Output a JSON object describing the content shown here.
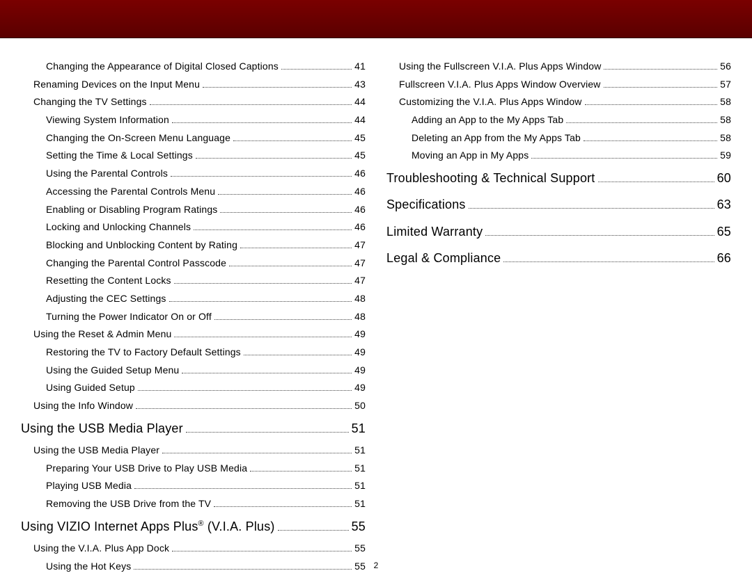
{
  "page_number": "2",
  "left": [
    {
      "class": "indent-2",
      "label": "Changing the Appearance of Digital Closed Captions",
      "page": "41"
    },
    {
      "class": "indent-1",
      "label": "Renaming Devices on the Input Menu",
      "page": "43"
    },
    {
      "class": "indent-1",
      "label": "Changing the TV Settings",
      "page": "44"
    },
    {
      "class": "indent-2",
      "label": "Viewing System Information",
      "page": "44"
    },
    {
      "class": "indent-2",
      "label": "Changing the On-Screen Menu Language",
      "page": "45"
    },
    {
      "class": "indent-2",
      "label": "Setting the Time & Local Settings",
      "page": "45"
    },
    {
      "class": "indent-2",
      "label": "Using the Parental Controls",
      "page": "46"
    },
    {
      "class": "indent-2",
      "label": "Accessing the Parental Controls Menu",
      "page": "46"
    },
    {
      "class": "indent-2",
      "label": "Enabling or Disabling Program Ratings",
      "page": "46"
    },
    {
      "class": "indent-2",
      "label": "Locking and Unlocking Channels",
      "page": "46"
    },
    {
      "class": "indent-2",
      "label": "Blocking and Unblocking Content by Rating",
      "page": "47"
    },
    {
      "class": "indent-2",
      "label": "Changing the Parental Control Passcode",
      "page": "47"
    },
    {
      "class": "indent-2",
      "label": "Resetting the Content Locks",
      "page": "47"
    },
    {
      "class": "indent-2",
      "label": "Adjusting the CEC Settings",
      "page": "48"
    },
    {
      "class": "indent-2",
      "label": "Turning the Power Indicator On or Off",
      "page": "48"
    },
    {
      "class": "indent-1",
      "label": "Using the Reset & Admin Menu",
      "page": "49"
    },
    {
      "class": "indent-2",
      "label": "Restoring the TV to Factory Default Settings",
      "page": "49"
    },
    {
      "class": "indent-2",
      "label": "Using the Guided Setup Menu",
      "page": "49"
    },
    {
      "class": "indent-2",
      "label": "Using Guided Setup",
      "page": "49"
    },
    {
      "class": "indent-1",
      "label": "Using the Info Window",
      "page": "50"
    },
    {
      "class": "heading",
      "label": "Using the USB Media Player",
      "page": "51"
    },
    {
      "class": "indent-1",
      "label": "Using the USB Media Player",
      "page": "51"
    },
    {
      "class": "indent-2",
      "label": "Preparing Your USB Drive to Play USB Media",
      "page": "51"
    },
    {
      "class": "indent-2",
      "label": "Playing USB Media",
      "page": "51"
    },
    {
      "class": "indent-2",
      "label": "Removing the USB Drive from the TV",
      "page": "51"
    },
    {
      "class": "heading",
      "label_html": "Using VIZIO Internet Apps Plus<sup>®</sup> (V.I.A. Plus)",
      "page": "55"
    },
    {
      "class": "indent-1",
      "label": "Using the V.I.A. Plus App Dock",
      "page": "55"
    },
    {
      "class": "indent-2",
      "label": "Using the Hot Keys",
      "page": "55"
    }
  ],
  "right": [
    {
      "class": "indent-1",
      "label": "Using the Fullscreen V.I.A. Plus Apps Window",
      "page": "56"
    },
    {
      "class": "indent-1",
      "label": "Fullscreen V.I.A. Plus Apps Window Overview",
      "page": "57"
    },
    {
      "class": "indent-1",
      "label": "Customizing the V.I.A. Plus Apps Window",
      "page": "58"
    },
    {
      "class": "indent-2",
      "label": "Adding an App to the My Apps Tab",
      "page": "58"
    },
    {
      "class": "indent-2",
      "label": "Deleting an App from the My Apps Tab",
      "page": "58"
    },
    {
      "class": "indent-2",
      "label": "Moving an App in My Apps",
      "page": "59"
    },
    {
      "class": "heading",
      "label": "Troubleshooting & Technical Support",
      "page": "60"
    },
    {
      "class": "heading",
      "label": "Specifications",
      "page": "63"
    },
    {
      "class": "heading",
      "label": "Limited Warranty",
      "page": "65"
    },
    {
      "class": "heading",
      "label": "Legal & Compliance",
      "page": "66"
    }
  ]
}
